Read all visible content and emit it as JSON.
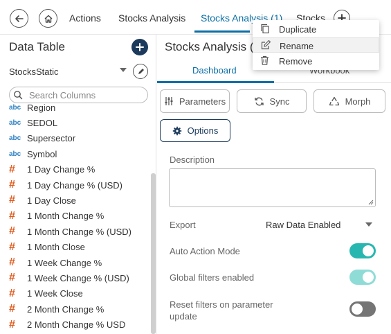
{
  "topbar": {
    "tabs": [
      "Actions",
      "Stocks Analysis",
      "Stocks Analysis (1)",
      "Stocks"
    ]
  },
  "left_panel": {
    "title": "Data Table",
    "source": "StocksStatic",
    "search_placeholder": "Search Columns",
    "columns": [
      {
        "type": "abc",
        "name": "Region"
      },
      {
        "type": "abc",
        "name": "SEDOL"
      },
      {
        "type": "abc",
        "name": "Supersector"
      },
      {
        "type": "abc",
        "name": "Symbol"
      },
      {
        "type": "#",
        "name": "1 Day Change %"
      },
      {
        "type": "#",
        "name": "1 Day Change % (USD)"
      },
      {
        "type": "#",
        "name": "1 Day Close"
      },
      {
        "type": "#",
        "name": "1 Month Change %"
      },
      {
        "type": "#",
        "name": "1 Month Change % (USD)"
      },
      {
        "type": "#",
        "name": "1 Month Close"
      },
      {
        "type": "#",
        "name": "1 Week Change %"
      },
      {
        "type": "#",
        "name": "1 Week Change % (USD)"
      },
      {
        "type": "#",
        "name": "1 Week Close"
      },
      {
        "type": "#",
        "name": "2 Month Change %"
      },
      {
        "type": "#",
        "name": "2 Month Change % USD"
      }
    ]
  },
  "right_panel": {
    "title": "Stocks Analysis (1",
    "tabs": {
      "dashboard": "Dashboard",
      "workbook": "Workbook"
    },
    "buttons": {
      "parameters": "Parameters",
      "sync": "Sync",
      "morph": "Morph",
      "options": "Options"
    },
    "description_label": "Description",
    "description_value": "",
    "export_label": "Export",
    "export_value": "Raw Data Enabled",
    "auto_action_label": "Auto Action Mode",
    "auto_action_on": true,
    "global_filters_label": "Global filters enabled",
    "global_filters_on": true,
    "reset_filters_label": "Reset filters on parameter update",
    "reset_filters_on": false
  },
  "context_menu": {
    "items": [
      "Duplicate",
      "Rename",
      "Remove"
    ],
    "highlighted": "Rename"
  },
  "colors": {
    "accent": "#0b6fa6",
    "navy": "#1c3b5c",
    "toggle_on": "#27b7b0",
    "number_type": "#e05a1c",
    "text_type": "#2a7fc1"
  }
}
